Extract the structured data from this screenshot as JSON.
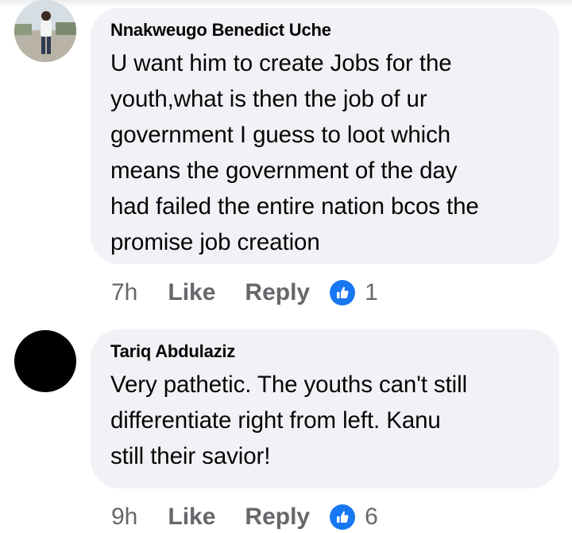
{
  "comments": [
    {
      "author": "Nnakweugo Benedict Uche",
      "lines": [
        "U want him to create Jobs for the",
        "youth,what is then the job of ur",
        "government I guess to loot which",
        "means the government of the day",
        "had failed the entire nation bcos the",
        "promise job creation"
      ],
      "time": "7h",
      "like_label": "Like",
      "reply_label": "Reply",
      "reaction_count": "1",
      "avatar": "profile-photo"
    },
    {
      "author": "Tariq Abdulaziz",
      "lines": [
        "Very pathetic. The youths can't still",
        "differentiate right from left. Kanu",
        "still their savior!"
      ],
      "time": "9h",
      "like_label": "Like",
      "reply_label": "Reply",
      "reaction_count": "6",
      "avatar": "black-circle"
    }
  ],
  "colors": {
    "bubble": "#f0f2f5",
    "meta_text": "#65676b",
    "like_blue": "#1877f2",
    "text": "#050505"
  }
}
